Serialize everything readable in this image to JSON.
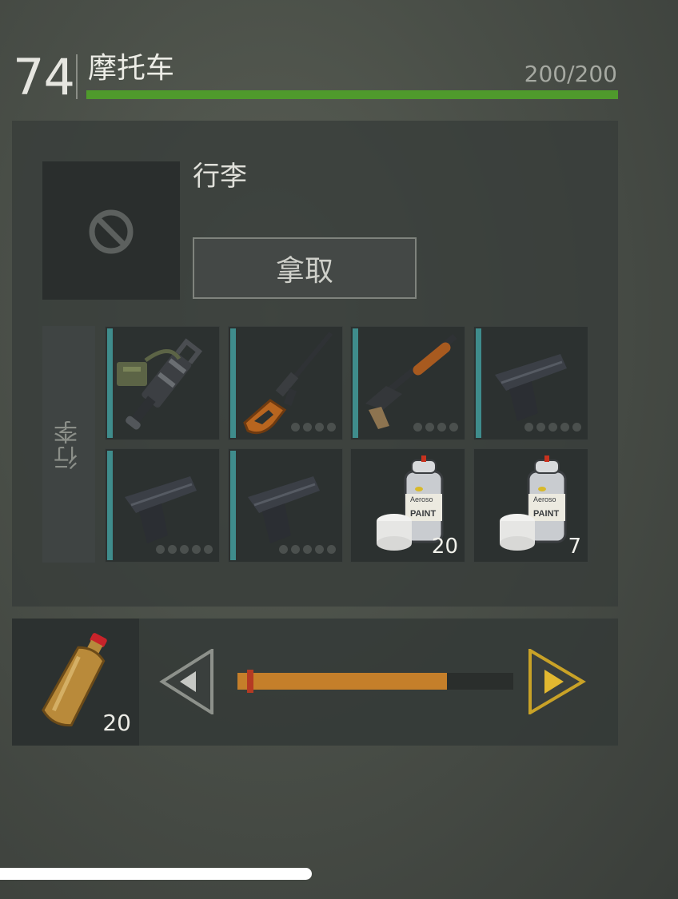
{
  "header": {
    "level": "74",
    "vehicle_name": "摩托车",
    "durability": "200/200",
    "durability_fraction": 1.0,
    "health_color": "#4f9a2c"
  },
  "container": {
    "label": "行李",
    "take_button": "拿取",
    "tab_label": "行李",
    "preview_icon": "blocked-icon"
  },
  "slots": [
    {
      "item": "minigun-icon",
      "quantity": "",
      "durability_pips": 0
    },
    {
      "item": "sniper-rifle-icon",
      "quantity": "",
      "durability_pips": 4
    },
    {
      "item": "shotgun-icon",
      "quantity": "",
      "durability_pips": 4
    },
    {
      "item": "pistol-icon",
      "quantity": "",
      "durability_pips": 5
    },
    {
      "item": "pistol-icon",
      "quantity": "",
      "durability_pips": 5
    },
    {
      "item": "pistol-icon",
      "quantity": "",
      "durability_pips": 5
    },
    {
      "item": "aerosol-paint-icon",
      "quantity": "20",
      "durability_pips": 0,
      "can_label": "Aeroso",
      "can_text": "PAINT"
    },
    {
      "item": "aerosol-paint-icon",
      "quantity": "7",
      "durability_pips": 0,
      "can_label": "Aeroso",
      "can_text": "PAINT"
    }
  ],
  "transfer": {
    "item": "bottle-icon",
    "quantity": "20",
    "slider_fraction": 0.76,
    "slider_color": "#c57f2a",
    "handle_color": "#b53a23",
    "right_arrow_color": "#c9a227"
  }
}
